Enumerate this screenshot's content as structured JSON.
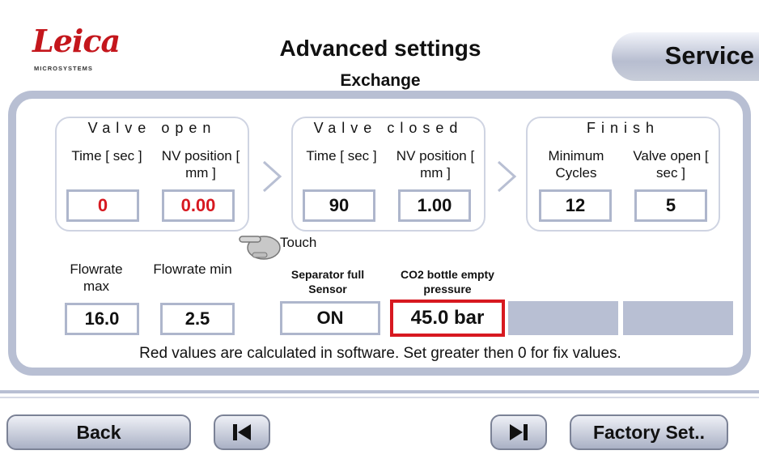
{
  "brand": {
    "logo_text": "Leica",
    "logo_sub": "MICROSYSTEMS"
  },
  "header": {
    "title": "Advanced settings",
    "subtitle": "Exchange",
    "tab_label": "Service"
  },
  "groups": {
    "valve_open": {
      "title": "Valve open",
      "time_label": "Time [ sec ]",
      "nv_label": "NV position [ mm ]",
      "time_value": "0",
      "nv_value": "0.00"
    },
    "valve_closed": {
      "title": "Valve closed",
      "time_label": "Time [ sec ]",
      "nv_label": "NV position [ mm ]",
      "time_value": "90",
      "nv_value": "1.00"
    },
    "finish": {
      "title": "Finish",
      "cycles_label": "Minimum Cycles",
      "valve_label": "Valve open [ sec ]",
      "cycles_value": "12",
      "valve_value": "5"
    }
  },
  "touch_hint": "Touch",
  "flow": {
    "max_label": "Flowrate max",
    "min_label": "Flowrate min",
    "max_value": "16.0",
    "min_value": "2.5"
  },
  "sensors": {
    "separator_label": "Separator full Sensor",
    "separator_value": "ON",
    "co2_label": "CO2 bottle empty pressure",
    "co2_value": "45.0 bar"
  },
  "note": "Red values are calculated in software. Set greater then 0 for fix values.",
  "footer": {
    "back_label": "Back",
    "first_label": "▌◀",
    "last_label": "▶▌",
    "factory_label": "Factory Set.."
  },
  "colors": {
    "accent_red": "#d71920",
    "frame": "#b8bfd3"
  }
}
